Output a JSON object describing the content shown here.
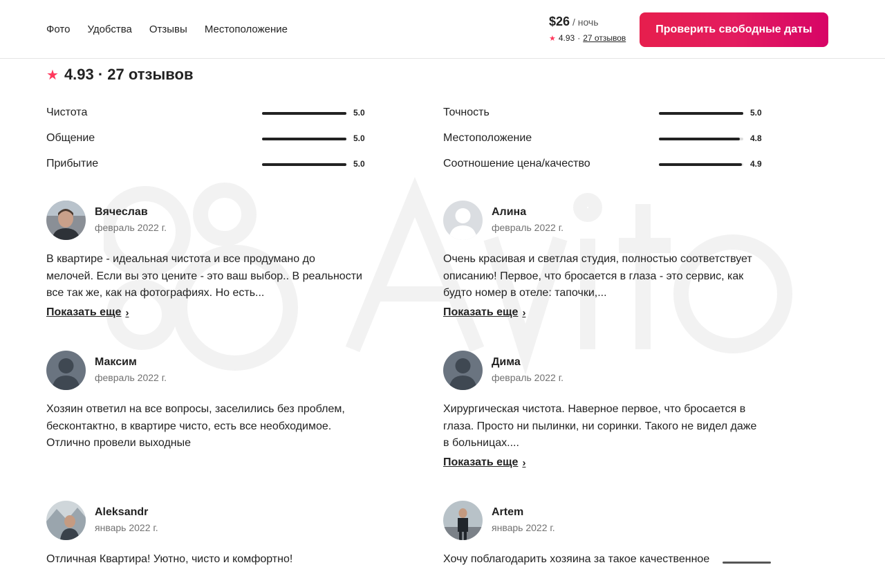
{
  "nav": {
    "items": [
      "Фото",
      "Удобства",
      "Отзывы",
      "Местоположение"
    ]
  },
  "booking": {
    "price": "$26",
    "per": "/ ночь",
    "rating": "4.93",
    "separator": "·",
    "reviews_link": "27 отзывов",
    "cta_label": "Проверить свободные даты"
  },
  "summary": {
    "text": "4.93 · 27 отзывов"
  },
  "categories": {
    "left": [
      {
        "label": "Чистота",
        "value": "5.0",
        "fill": 1.0
      },
      {
        "label": "Общение",
        "value": "5.0",
        "fill": 1.0
      },
      {
        "label": "Прибытие",
        "value": "5.0",
        "fill": 1.0
      }
    ],
    "right": [
      {
        "label": "Точность",
        "value": "5.0",
        "fill": 1.0
      },
      {
        "label": "Местоположение",
        "value": "4.8",
        "fill": 0.96
      },
      {
        "label": "Соотношение цена/качество",
        "value": "4.9",
        "fill": 0.98
      }
    ]
  },
  "reviews": [
    {
      "name": "Вячеслав",
      "date": "февраль 2022 г.",
      "text": "В квартире - идеальная чистота и все продумано до мелочей. Если вы это цените - это ваш выбор.. В реальности все так же, как на фотографиях. Но есть...",
      "more": "Показать еще",
      "avatar": "photo-man-icon"
    },
    {
      "name": "Алина",
      "date": "февраль 2022 г.",
      "text": "Очень красивая и светлая студия, полностью соответствует описанию! Первое, что бросается в глаза - это сервис, как будто номер в отеле: тапочки,...",
      "more": "Показать еще",
      "avatar": "default-user-icon"
    },
    {
      "name": "Максим",
      "date": "февраль 2022 г.",
      "text": "Хозяин ответил на все вопросы, заселились без проблем, бесконтактно, в квартире чисто, есть все необходимое. Отлично провели выходные",
      "more": "",
      "avatar": "default-user-dark-icon"
    },
    {
      "name": "Дима",
      "date": "февраль 2022 г.",
      "text": "Хирургическая чистота. Наверное первое, что бросается в глаза. Просто ни пылинки, ни соринки. Такого не видел даже в больницах....",
      "more": "Показать еще",
      "avatar": "default-user-dark-icon"
    },
    {
      "name": "Aleksandr",
      "date": "январь 2022 г.",
      "text": "Отличная Квартира! Уютно, чисто и комфортно!",
      "more": "",
      "avatar": "photo-man-icon"
    },
    {
      "name": "Artem",
      "date": "январь 2022 г.",
      "text": "Хочу поблагодарить хозяина за такое качественное",
      "more": "",
      "avatar": "photo-man-icon"
    }
  ],
  "watermark": {
    "logo": "Avito"
  },
  "colors": {
    "accent": "#ff385c",
    "cta_start": "#e61e4d",
    "cta_end": "#d70466",
    "text": "#222222",
    "muted": "#717171"
  }
}
